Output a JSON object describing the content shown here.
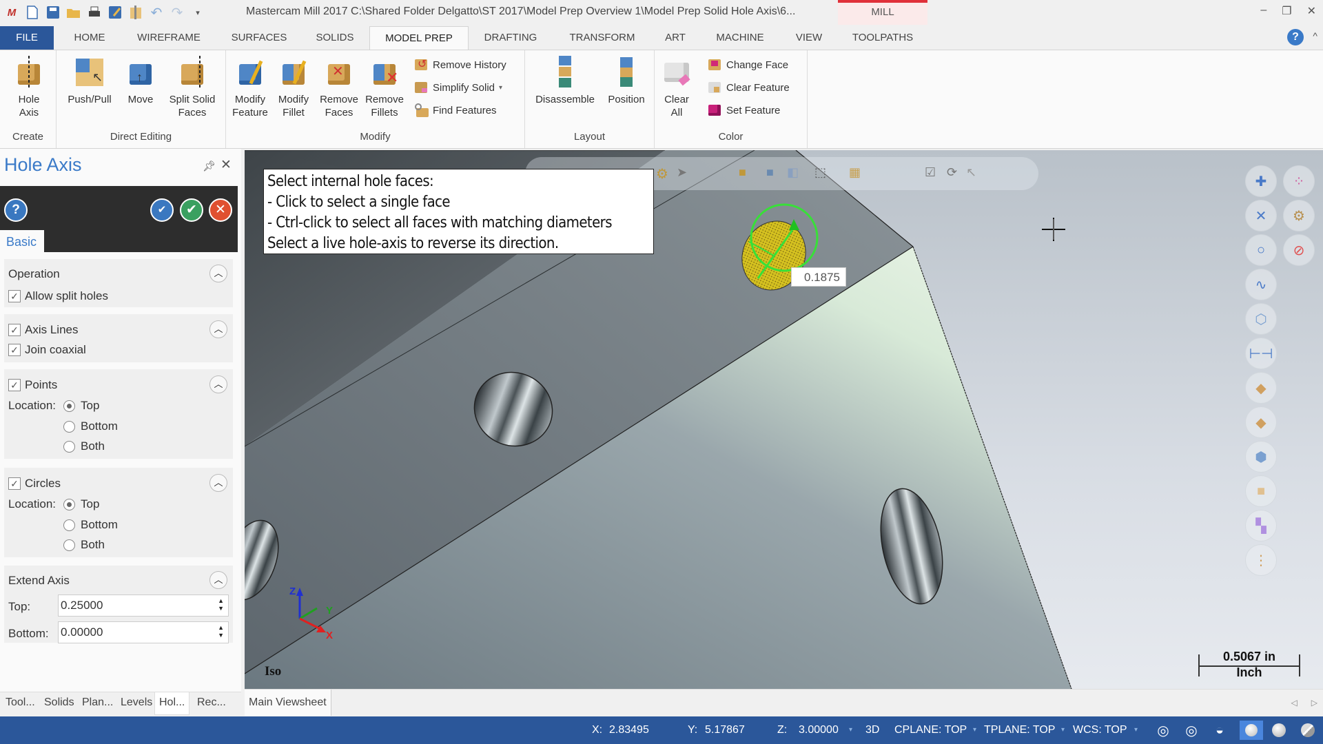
{
  "window": {
    "title": "Mastercam Mill 2017  C:\\Shared Folder Delgatto\\ST 2017\\Model Prep Overview 1\\Model Prep Solid Hole Axis\\6...",
    "context_tab": "MILL",
    "controls": {
      "minimize": "–",
      "restore": "❐",
      "close": "✕"
    }
  },
  "quick_access": [
    "app-logo-icon",
    "new-file-icon",
    "save-icon",
    "open-icon",
    "print-icon",
    "save-as-icon",
    "zip2go-icon",
    "undo-icon",
    "redo-icon",
    "customize-icon"
  ],
  "ribbon_tabs": [
    {
      "label": "FILE"
    },
    {
      "label": "HOME"
    },
    {
      "label": "WIREFRAME"
    },
    {
      "label": "SURFACES"
    },
    {
      "label": "SOLIDS"
    },
    {
      "label": "MODEL PREP",
      "active": true
    },
    {
      "label": "DRAFTING"
    },
    {
      "label": "TRANSFORM"
    },
    {
      "label": "ART"
    },
    {
      "label": "MACHINE"
    },
    {
      "label": "VIEW"
    },
    {
      "label": "TOOLPATHS"
    }
  ],
  "ribbon": {
    "groups": {
      "create": "Create",
      "direct_editing": "Direct Editing",
      "modify": "Modify",
      "layout": "Layout",
      "color": "Color"
    },
    "buttons": {
      "hole_axis": [
        "Hole",
        "Axis"
      ],
      "push_pull": [
        "Push/Pull"
      ],
      "move": [
        "Move"
      ],
      "split_solid_faces": [
        "Split Solid",
        "Faces"
      ],
      "modify_feature": [
        "Modify",
        "Feature"
      ],
      "modify_fillet": [
        "Modify",
        "Fillet"
      ],
      "remove_faces": [
        "Remove",
        "Faces"
      ],
      "remove_fillets": [
        "Remove",
        "Fillets"
      ],
      "remove_history": "Remove History",
      "simplify_solid": "Simplify Solid",
      "find_features": "Find Features",
      "disassemble": "Disassemble",
      "position": "Position",
      "clear_all": [
        "Clear",
        "All"
      ],
      "change_face": "Change Face",
      "clear_feature": "Clear Feature",
      "set_feature": "Set Feature"
    }
  },
  "panel": {
    "title": "Hole Axis",
    "tab": "Basic",
    "operation": {
      "header": "Operation",
      "allow_split_holes": {
        "label": "Allow split holes",
        "checked": true
      }
    },
    "axis_lines": {
      "label": "Axis Lines",
      "checked": true,
      "join_coaxial": {
        "label": "Join coaxial",
        "checked": true
      }
    },
    "points": {
      "label": "Points",
      "checked": true,
      "location_label": "Location:",
      "options": [
        "Top",
        "Bottom",
        "Both"
      ],
      "selected": "Top"
    },
    "circles": {
      "label": "Circles",
      "checked": true,
      "location_label": "Location:",
      "options": [
        "Top",
        "Bottom",
        "Both"
      ],
      "selected": "Top"
    },
    "extend_axis": {
      "header": "Extend Axis",
      "top_label": "Top:",
      "top_value": "0.25000",
      "bottom_label": "Bottom:",
      "bottom_value": "0.00000"
    },
    "bottom_tabs": [
      "Tool...",
      "Solids",
      "Plan...",
      "Levels",
      "Hol...",
      "Rec..."
    ],
    "active_bottom_tab": "Hol..."
  },
  "viewport": {
    "prompt_lines": [
      "Select internal hole faces:",
      "- Click to select a single face",
      "- Ctrl-click to select all faces with matching diameters",
      "Select a live hole-axis to reverse its direction."
    ],
    "dimension_label": "0.1875",
    "view_name": "Iso",
    "scale": {
      "value": "0.5067 in",
      "unit": "Inch"
    },
    "axes": {
      "x": "X",
      "y": "Y",
      "z": "Z"
    },
    "selection_color": "#d4c020",
    "axis_colors": {
      "x": "#e02020",
      "y": "#20a020",
      "z": "#2030d0"
    }
  },
  "viewsheet": {
    "tab": "Main Viewsheet"
  },
  "status": {
    "x_label": "X:",
    "x": "2.83495",
    "y_label": "Y:",
    "y": "5.17867",
    "z_label": "Z:",
    "z": "3.00000",
    "mode": "3D",
    "cplane": "CPLANE: TOP",
    "tplane": "TPLANE: TOP",
    "wcs": "WCS: TOP"
  }
}
